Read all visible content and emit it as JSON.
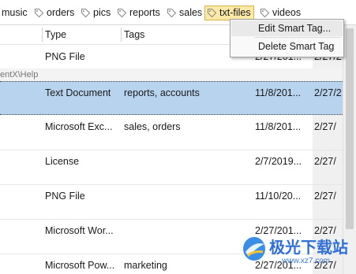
{
  "tagbar": {
    "tags": [
      {
        "label": "music",
        "icon": "tag-icon",
        "selected": false
      },
      {
        "label": "orders",
        "icon": "tag-icon",
        "selected": false
      },
      {
        "label": "pics",
        "icon": "tag-icon",
        "selected": false
      },
      {
        "label": "reports",
        "icon": "tag-icon",
        "selected": false
      },
      {
        "label": "sales",
        "icon": "tag-icon",
        "selected": false
      },
      {
        "label": "txt-files",
        "icon": "tag-icon",
        "selected": true
      },
      {
        "label": "videos",
        "icon": "tag-icon",
        "selected": false
      }
    ]
  },
  "header": {
    "type": "Type",
    "tags": "Tags"
  },
  "path_label": "entX\\Help",
  "rows": [
    {
      "type": "PNG File",
      "tags": "",
      "modified": "2/27/201...",
      "created": "2/27/2..."
    },
    {
      "type": "Text Document",
      "tags": "reports, accounts",
      "modified": "11/8/201...",
      "created": "2/27/2..."
    },
    {
      "type": "Microsoft Exc...",
      "tags": "sales, orders",
      "modified": "11/8/201...",
      "created": "2/27/"
    },
    {
      "type": "License",
      "tags": "",
      "modified": "2/7/2019...",
      "created": "2/27/"
    },
    {
      "type": "PNG File",
      "tags": "",
      "modified": "11/10/20...",
      "created": "2/27/"
    },
    {
      "type": "Microsoft Wor...",
      "tags": "",
      "modified": "2/27/201...",
      "created": "2/27/"
    },
    {
      "type": "Microsoft Pow...",
      "tags": "marketing",
      "modified": "2/27/201...",
      "created": "2/27/"
    }
  ],
  "context_menu": {
    "items": [
      {
        "label": "Edit Smart Tag..."
      },
      {
        "label": "Delete Smart Tag"
      }
    ]
  },
  "watermark": {
    "text": "极光下载站",
    "url": "www.xz7.com"
  },
  "colors": {
    "selected_row": "#b7d3ee",
    "selected_tag": "#fbe9a6",
    "tag_icon": "#8a8a8a"
  }
}
